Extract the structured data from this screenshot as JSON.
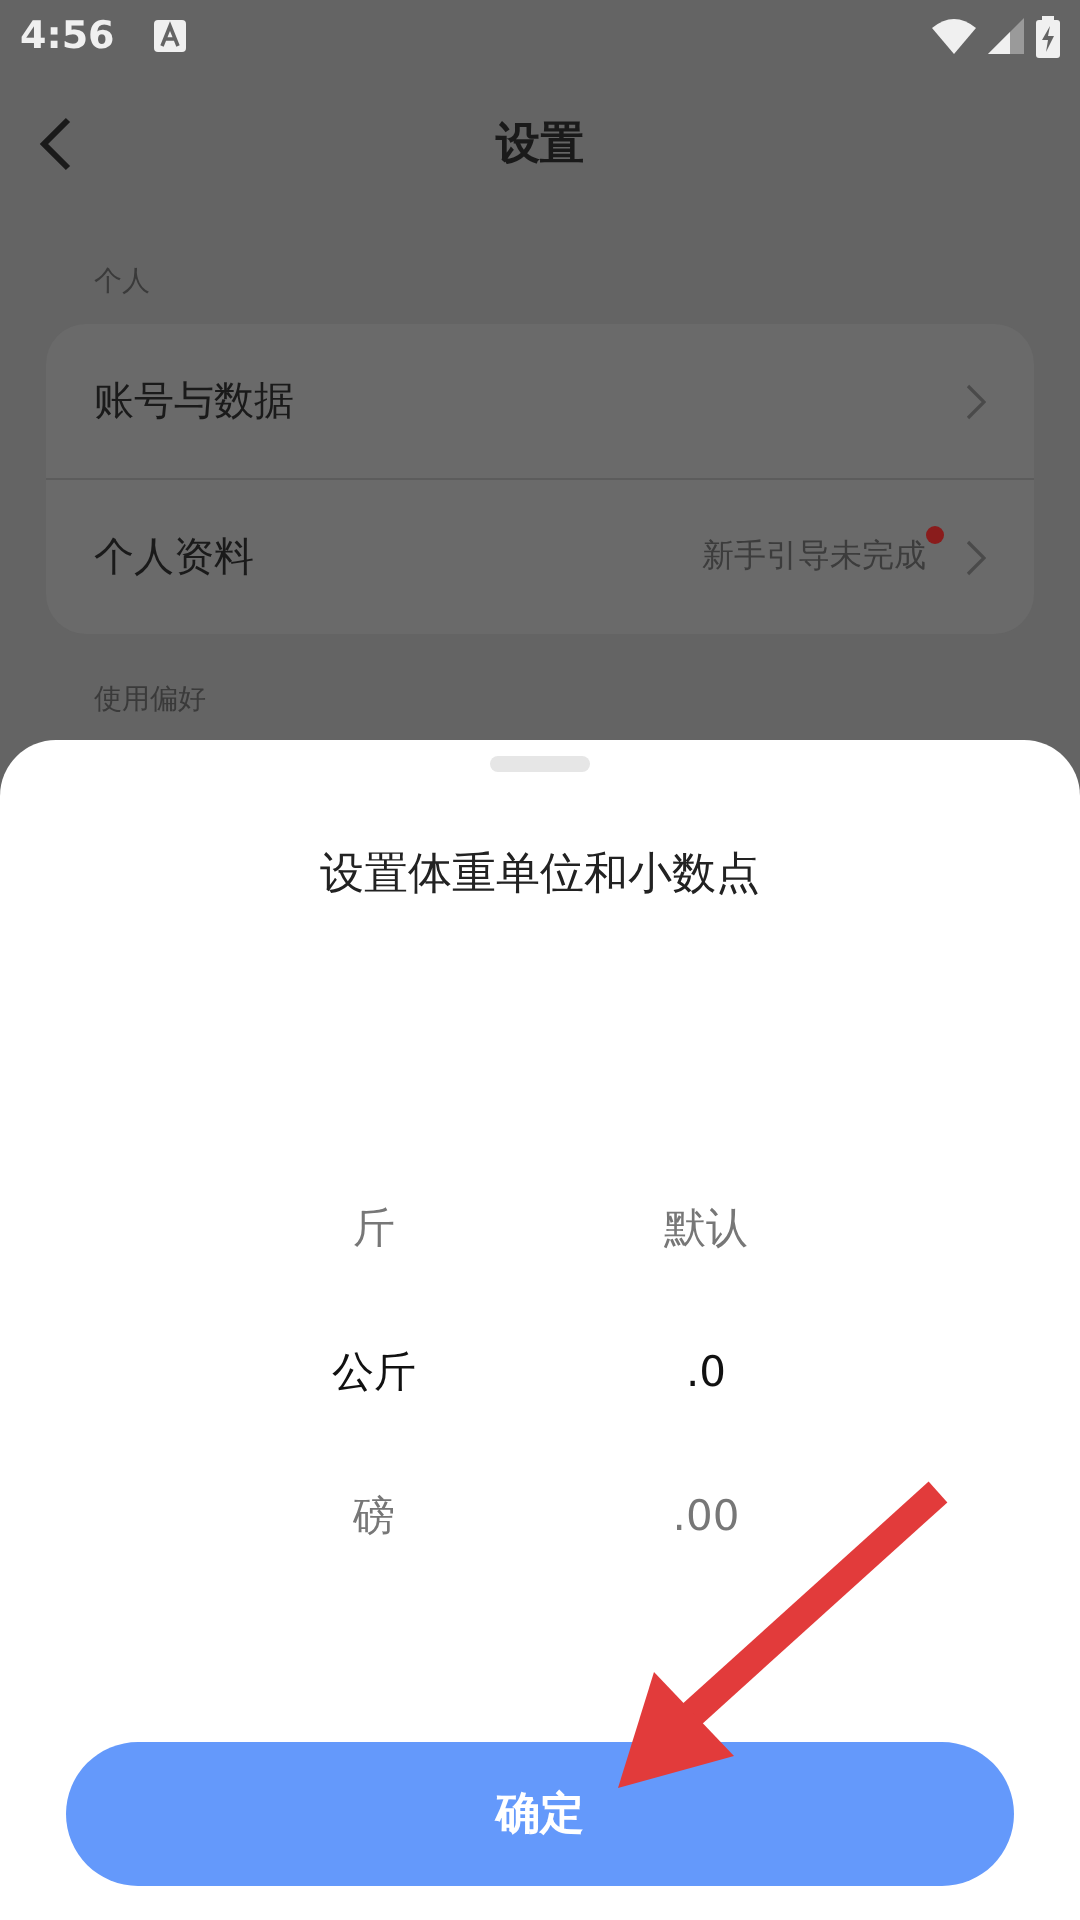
{
  "status_bar": {
    "time": "4:56"
  },
  "header": {
    "title": "设置"
  },
  "sections": [
    {
      "label": "个人",
      "items": [
        {
          "label": "账号与数据",
          "badge": false
        },
        {
          "label": "个人资料",
          "value": "新手引导未完成",
          "badge": true
        }
      ]
    },
    {
      "label": "使用偏好"
    }
  ],
  "sheet": {
    "title": "设置体重单位和小数点",
    "columns": [
      {
        "options": [
          {
            "label": "斤",
            "selected": false
          },
          {
            "label": "公斤",
            "selected": true
          },
          {
            "label": "磅",
            "selected": false
          }
        ]
      },
      {
        "options": [
          {
            "label": "默认",
            "selected": false
          },
          {
            "label": ".0",
            "selected": true
          },
          {
            "label": ".00",
            "selected": false
          }
        ]
      }
    ],
    "confirm_button": "确定"
  }
}
